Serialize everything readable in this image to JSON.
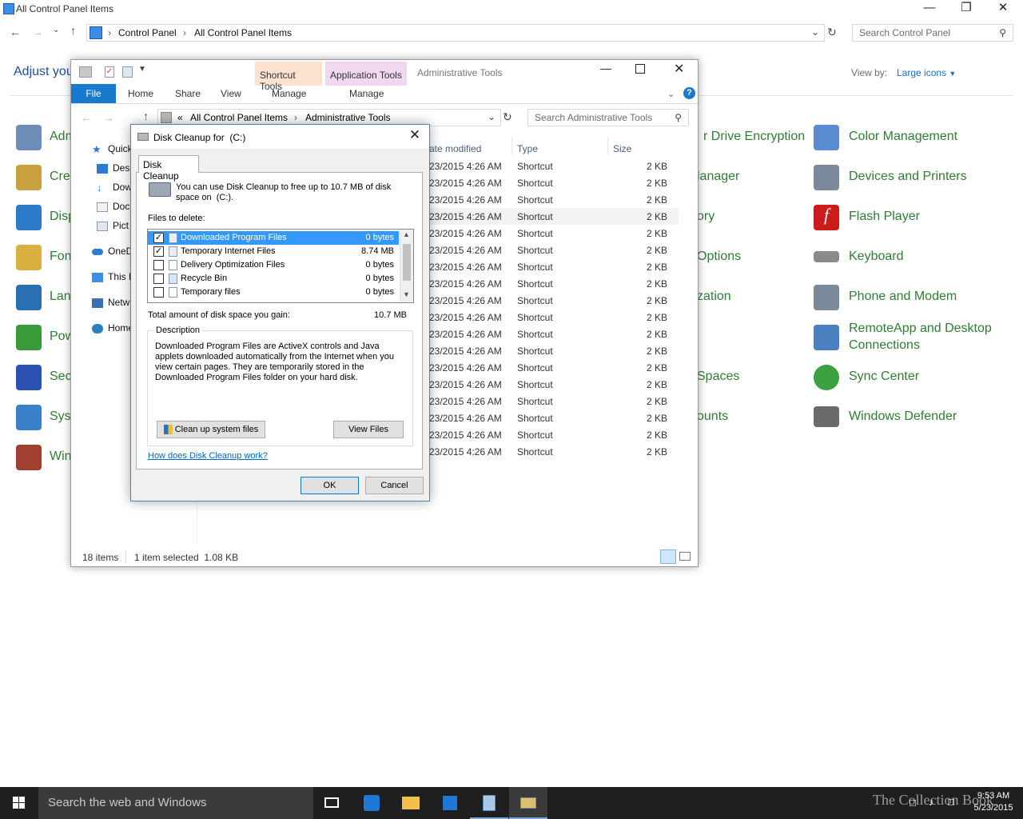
{
  "control_panel": {
    "title": "All Control Panel Items",
    "breadcrumb": [
      "Control Panel",
      "All Control Panel Items"
    ],
    "search_placeholder": "Search Control Panel",
    "heading": "Adjust you",
    "view_by_label": "View by:",
    "view_by_value": "Large icons",
    "left_items": [
      {
        "label": "Adm",
        "icon": "administrative-tools-icon",
        "color": "#6b8db8"
      },
      {
        "label": "Cre",
        "icon": "credential-manager-icon",
        "color": "#c8a040"
      },
      {
        "label": "Disp",
        "icon": "display-icon",
        "color": "#2c7ac8"
      },
      {
        "label": "Fon",
        "icon": "fonts-icon",
        "color": "#d8b040"
      },
      {
        "label": "Lan",
        "icon": "language-icon",
        "color": "#2a70b0"
      },
      {
        "label": "Pow",
        "icon": "power-options-icon",
        "color": "#3a9a3a"
      },
      {
        "label": "Secu",
        "icon": "security-flag-icon",
        "color": "#2a50b0"
      },
      {
        "label": "Syst",
        "icon": "system-icon",
        "color": "#3a80c8"
      },
      {
        "label": "Win",
        "icon": "windows-firewall-icon",
        "color": "#a04030"
      }
    ],
    "middle_items": [
      {
        "label": "r Drive Encryption"
      },
      {
        "label": "lanager"
      },
      {
        "label": "ory"
      },
      {
        "label": "Options"
      },
      {
        "label": "zation"
      },
      {
        "label": "Spaces"
      },
      {
        "label": "ounts"
      }
    ],
    "right_items": [
      {
        "label": "Color Management",
        "icon": "color-management-icon",
        "color": "#5a8ad0"
      },
      {
        "label": "Devices and Printers",
        "icon": "devices-printers-icon",
        "color": "#7a8a9a"
      },
      {
        "label": "Flash Player",
        "icon": "flash-player-icon",
        "color": "#cc1b1b"
      },
      {
        "label": "Keyboard",
        "icon": "keyboard-icon",
        "color": "#8a8a8a"
      },
      {
        "label": "Phone and Modem",
        "icon": "phone-modem-icon",
        "color": "#7a8a9a"
      },
      {
        "label": "RemoteApp and Desktop",
        "label2": "Connections",
        "icon": "remoteapp-icon",
        "color": "#4a80c0"
      },
      {
        "label": "Sync Center",
        "icon": "sync-center-icon",
        "color": "#3aa040"
      },
      {
        "label": "Windows Defender",
        "icon": "windows-defender-icon",
        "color": "#6a6a6a"
      }
    ]
  },
  "admin_tools": {
    "title": "Administrative Tools",
    "context_tabs": [
      "Shortcut Tools",
      "Application Tools"
    ],
    "ribbon_tabs": [
      "File",
      "Home",
      "Share",
      "View"
    ],
    "manage_labels": [
      "Manage",
      "Manage"
    ],
    "breadcrumb_prefix": "«",
    "breadcrumb": [
      "All Control Panel Items",
      "Administrative Tools"
    ],
    "search_placeholder": "Search Administrative Tools",
    "nav": [
      {
        "label": "Quick",
        "icon": "star-icon",
        "color": "#2b7bd6"
      },
      {
        "label": "Desk",
        "icon": "desktop-icon",
        "color": "#2b7bd6"
      },
      {
        "label": "Dow",
        "icon": "downloads-icon",
        "color": "#2b7bd6"
      },
      {
        "label": "Doc",
        "icon": "documents-icon",
        "color": "#8a9aaa"
      },
      {
        "label": "Pict",
        "icon": "pictures-icon",
        "color": "#8a9aaa"
      },
      {
        "label": "OneD",
        "icon": "onedrive-icon",
        "color": "#2b7bd6"
      },
      {
        "label": "This P",
        "icon": "this-pc-icon",
        "color": "#3a8ee6"
      },
      {
        "label": "Netw",
        "icon": "network-icon",
        "color": "#3a70b0"
      },
      {
        "label": "Home",
        "icon": "homegroup-icon",
        "color": "#2a80c0"
      }
    ],
    "columns": [
      "ate modified",
      "Type",
      "Size"
    ],
    "rows_date": "23/2015 4:26 AM",
    "rows_type": "Shortcut",
    "rows_size": "2 KB",
    "row_count": 18,
    "selected_row": 3,
    "status_items": "18 items",
    "status_selected": "1 item selected  1.08 KB"
  },
  "disk_cleanup": {
    "title": "Disk Cleanup for  (C:)",
    "tab": "Disk Cleanup",
    "intro": "You can use Disk Cleanup to free up to 10.7 MB of disk space on  (C:).",
    "files_label": "Files to delete:",
    "files": [
      {
        "name": "Downloaded Program Files",
        "size": "0 bytes",
        "checked": true,
        "selected": true
      },
      {
        "name": "Temporary Internet Files",
        "size": "8.74 MB",
        "checked": true,
        "selected": false
      },
      {
        "name": "Delivery Optimization Files",
        "size": "0 bytes",
        "checked": false,
        "selected": false
      },
      {
        "name": "Recycle Bin",
        "size": "0 bytes",
        "checked": false,
        "selected": false
      },
      {
        "name": "Temporary files",
        "size": "0 bytes",
        "checked": false,
        "selected": false
      }
    ],
    "total_label": "Total amount of disk space you gain:",
    "total_value": "10.7 MB",
    "description_label": "Description",
    "description": "Downloaded Program Files are ActiveX controls and Java applets downloaded automatically from the Internet when you view certain pages. They are temporarily stored in the Downloaded Program Files folder on your hard disk.",
    "cleanup_button": "Clean up system files",
    "view_files_button": "View Files",
    "help_link": "How does Disk Cleanup work?",
    "ok": "OK",
    "cancel": "Cancel"
  },
  "taskbar": {
    "search_placeholder": "Search the web and Windows",
    "time": "9:53 AM",
    "date": "5/23/2015",
    "watermark": "The Collection Book"
  }
}
